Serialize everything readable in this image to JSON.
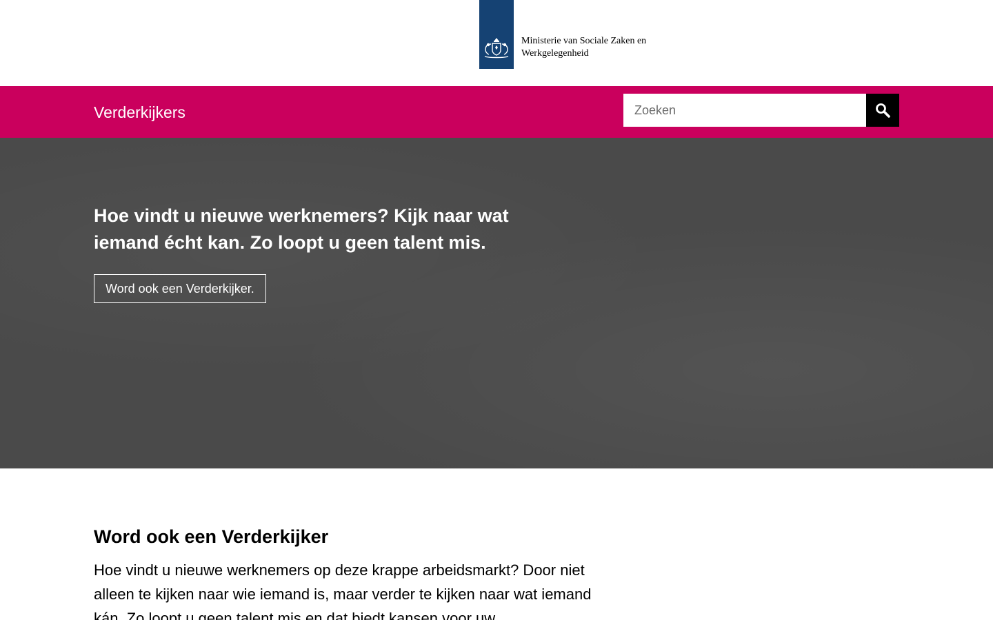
{
  "header": {
    "logo_line1": "Ministerie van Sociale Zaken en",
    "logo_line2": "Werkgelegenheid",
    "logo_icon": "rijksoverheid-coat-of-arms-icon"
  },
  "nav": {
    "site_title": "Verderkijkers",
    "search_placeholder": "Zoeken",
    "search_icon": "search-icon"
  },
  "hero": {
    "title": "Hoe vindt u nieuwe werknemers? Kijk naar wat iemand écht kan. Zo loopt u geen talent mis.",
    "button_label": "Word ook een Verderkijker."
  },
  "main": {
    "heading": "Word ook een Verderkijker",
    "intro": "Hoe vindt u nieuwe werknemers op deze krappe arbeidsmarkt? Door niet alleen te kijken naar wie iemand is, maar verder te kijken naar wat iemand kán. Zo loopt u geen talent mis en dat biedt kansen voor uw"
  },
  "colors": {
    "nav_pink": "#ca005d",
    "logo_blue": "#154273",
    "hero_gray": "#4a4a4a"
  }
}
